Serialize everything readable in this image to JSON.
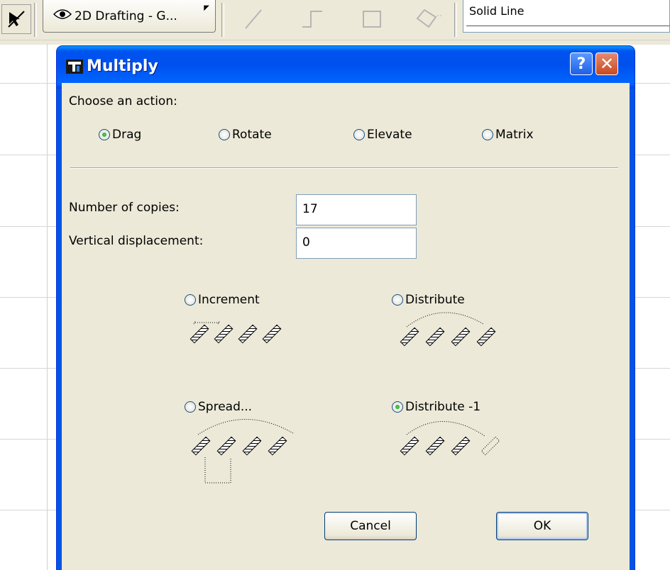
{
  "toolbar": {
    "layer_combo_label": "2D Drafting - G...",
    "line_type_value": "Solid Line",
    "tools": [
      "line-tool-icon",
      "polyline-tool-icon",
      "rectangle-tool-icon",
      "rotated-rectangle-tool-icon"
    ]
  },
  "dialog": {
    "title": "Multiply",
    "help_label": "?",
    "close_label": "✕",
    "choose_action_label": "Choose an action:",
    "actions": [
      {
        "label": "Drag",
        "selected": true
      },
      {
        "label": "Rotate",
        "selected": false
      },
      {
        "label": "Elevate",
        "selected": false
      },
      {
        "label": "Matrix",
        "selected": false
      }
    ],
    "copies_label": "Number of copies:",
    "copies_value": "17",
    "vertical_label": "Vertical displacement:",
    "vertical_value": "0",
    "modes": [
      {
        "label": "Increment",
        "selected": false
      },
      {
        "label": "Distribute",
        "selected": false
      },
      {
        "label": "Spread...",
        "selected": false
      },
      {
        "label": "Distribute -1",
        "selected": true
      }
    ],
    "cancel_label": "Cancel",
    "ok_label": "OK"
  },
  "colors": {
    "title_bar": "#0055e5",
    "dialog_face": "#ece9d8",
    "radio_selected": "#21a121"
  }
}
